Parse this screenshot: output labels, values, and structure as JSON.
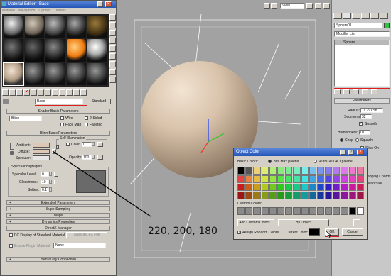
{
  "material_editor": {
    "title": "Material Editor - Base",
    "menu": [
      "Material",
      "Navigation",
      "Options",
      "Utilities"
    ],
    "material_name": "Base",
    "material_type": "Standard",
    "shader_rollout": "Shader Basic Parameters",
    "shader_type": "Blinn",
    "shader_checks": [
      "Wire",
      "2-Sided",
      "Face Map",
      "Faceted"
    ],
    "blinn_rollout": "Blinn Basic Parameters",
    "self_illum_group": "Self-Illumination",
    "color_label": "Color",
    "color_value": "0",
    "ambient_label": "Ambient:",
    "diffuse_label": "Diffuse:",
    "specular_label": "Specular:",
    "opacity_label": "Opacity:",
    "opacity_value": "100",
    "spec_group": "Specular Highlights",
    "spec_level_label": "Specular Level:",
    "spec_level_value": "0",
    "glossiness_label": "Glossiness:",
    "glossiness_value": "10",
    "soften_label": "Soften:",
    "soften_value": "0.1",
    "rollouts_bottom": [
      "Extended Parameters",
      "SuperSampling",
      "Maps",
      "Dynamics Properties",
      "DirectX Manager"
    ],
    "dx_display_label": "DX Display of Standard Material",
    "save_fx_label": "Save as .FX File",
    "enable_plugin_label": "Enable Plugin Material",
    "plugin_value": "None",
    "mental_ray_label": "mental ray Connection",
    "diffuse_color": "#dcc8b4"
  },
  "annotation": {
    "rgb_text": "220, 200, 180"
  },
  "viewport": {
    "dropdown_value": "View"
  },
  "command_panel": {
    "object_name": "Sphere01",
    "modifier_list_label": "Modifier List",
    "stack_item": "Sphere",
    "parameters_label": "Parameters",
    "radius_label": "Radius:",
    "radius_value": "11.291cm",
    "segments_label": "Segments:",
    "segments_value": "32",
    "smooth_label": "Smooth",
    "hemisphere_label": "Hemisphere:",
    "hemisphere_value": "0.0",
    "chop_label": "Chop",
    "squash_label": "Squash",
    "slice_on_label": "Slice On",
    "mapping_label": "apping Coords",
    "map_size_label": "Map Size",
    "object_color": "#2ec440"
  },
  "object_color_dialog": {
    "title": "Object Color",
    "basic_colors_label": "Basic Colors:",
    "palette_3dsmax": "3ds Max palette",
    "palette_autocad": "AutoCAD ACI palette",
    "custom_colors_label": "Custom Colors:",
    "add_custom_label": "Add Custom Colors...",
    "by_object_label": "By Object",
    "assign_random_label": "Assign Random Colors",
    "current_color_label": "Current Color:",
    "ok_label": "OK",
    "cancel_label": "Cancel"
  }
}
